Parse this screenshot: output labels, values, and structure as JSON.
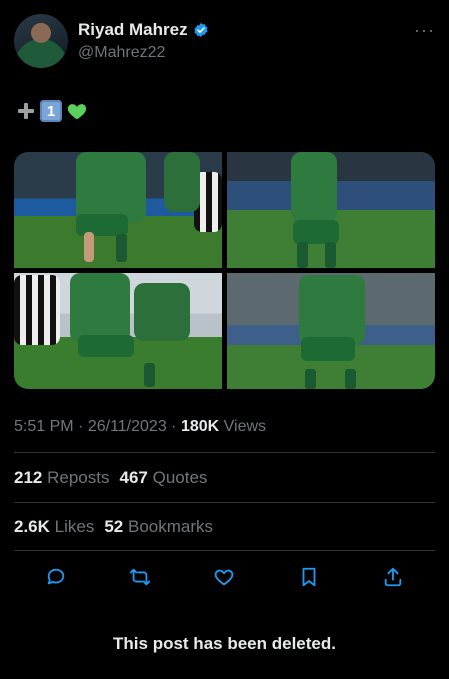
{
  "author": {
    "name": "Riyad Mahrez",
    "handle": "@Mahrez22"
  },
  "tweet": {
    "keycap": "1",
    "emoji_names": [
      "plus-icon",
      "keycap-one",
      "green-heart-icon"
    ]
  },
  "media": {
    "tiles": [
      "photo-1",
      "photo-2",
      "photo-3",
      "photo-4"
    ]
  },
  "meta": {
    "time": "5:51 PM",
    "sep1": "·",
    "date": "26/11/2023",
    "sep2": "·",
    "views_count": "180K",
    "views_label": "Views"
  },
  "stats": {
    "reposts_count": "212",
    "reposts_label": "Reposts",
    "quotes_count": "467",
    "quotes_label": "Quotes",
    "likes_count": "2.6K",
    "likes_label": "Likes",
    "bookmarks_count": "52",
    "bookmarks_label": "Bookmarks"
  },
  "actions": [
    "reply-icon",
    "repost-icon",
    "like-icon",
    "bookmark-icon",
    "share-icon"
  ],
  "notice": "This post has been deleted.",
  "colors": {
    "background": "#000000",
    "text": "#e7e9ea",
    "muted": "#71767b",
    "divider": "#2f3336",
    "verified": "#1d9bf0",
    "heart": "#5bd05b"
  }
}
